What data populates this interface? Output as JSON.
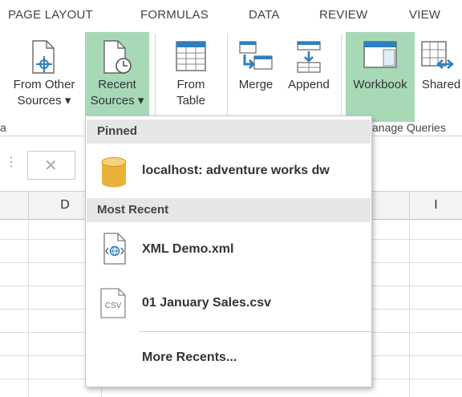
{
  "tabs": [
    "PAGE LAYOUT",
    "FORMULAS",
    "DATA",
    "REVIEW",
    "VIEW"
  ],
  "ribbon": {
    "from_other_sources": [
      "From Other",
      "Sources ▾"
    ],
    "recent_sources": [
      "Recent",
      "Sources ▾"
    ],
    "from_table": [
      "From",
      "Table"
    ],
    "merge": "Merge",
    "append": "Append",
    "workbook": "Workbook",
    "shared": "Shared",
    "group_left": "a",
    "group_manage": "anage Queries"
  },
  "formula_bar": {
    "cancel_icon": "✕",
    "dots": "⋮"
  },
  "columns": [
    "D",
    "I"
  ],
  "dropdown": {
    "pinned_header": "Pinned",
    "pinned": [
      {
        "label": "localhost: adventure works dw",
        "icon": "database-icon"
      }
    ],
    "recent_header": "Most Recent",
    "recent": [
      {
        "label": "XML Demo.xml",
        "icon": "xml-file-icon"
      },
      {
        "label": "01 January Sales.csv",
        "icon": "csv-file-icon",
        "icon_text": "CSV"
      }
    ],
    "more": "More Recents..."
  },
  "colors": {
    "highlight": "#a7d9b7",
    "header_bg": "#e6e6e6",
    "db_gold": "#e8b23a"
  }
}
